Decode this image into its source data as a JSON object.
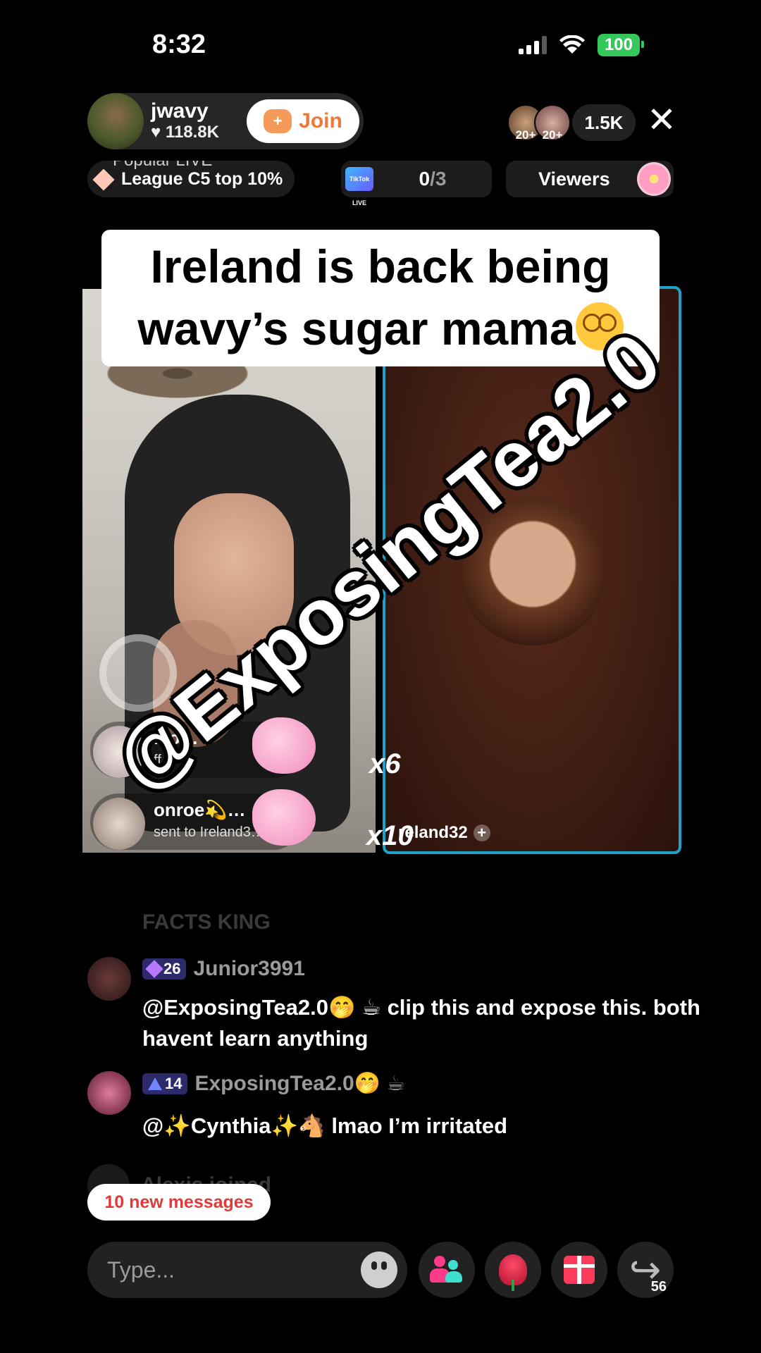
{
  "status_bar": {
    "time": "8:32",
    "battery": "100"
  },
  "host": {
    "name": "jwavy",
    "likes": "118.8K",
    "join_label": "Join"
  },
  "top_right": {
    "viewer_badges": [
      "20+",
      "20+"
    ],
    "viewer_count": "1.5K",
    "close": "✕"
  },
  "badges": {
    "popular_partial": "Popular LIVE",
    "league": "League C5 top 10%",
    "goal_icon": "TikTok LIVE",
    "goal_current": "0",
    "goal_total": "/3",
    "viewers_label": "Viewers"
  },
  "caption": {
    "line1": "Ireland is back being",
    "line2": "wavy’s sugar mama"
  },
  "watermark": "@ExposingTea2.0",
  "gifts": [
    {
      "name": "Mo…",
      "sub": "ff",
      "multiplier": "x6"
    },
    {
      "name": "onroe💫…",
      "sub": "sent to Ireland3…",
      "multiplier": "x10"
    }
  ],
  "guest": {
    "name": "reland32"
  },
  "chat": {
    "faded_top": "FACTS KING",
    "messages": [
      {
        "level": "26",
        "user": "Junior3991",
        "text": "@ExposingTea2.0🤭 ☕ clip this and expose this. both havent learn anything"
      },
      {
        "level": "14",
        "user": "ExposingTea2.0🤭 ☕",
        "text": "@✨Cynthia✨🐴 lmao I’m irritated"
      }
    ],
    "joined": "Alexis joined",
    "new_messages": "10 new messages"
  },
  "bottom_bar": {
    "placeholder": "Type...",
    "share_count": "56"
  },
  "colors": {
    "join_orange": "#f0773a",
    "guest_border": "#1ea2c9",
    "battery_green": "#34c759",
    "new_msg_red": "#e03a3a"
  }
}
